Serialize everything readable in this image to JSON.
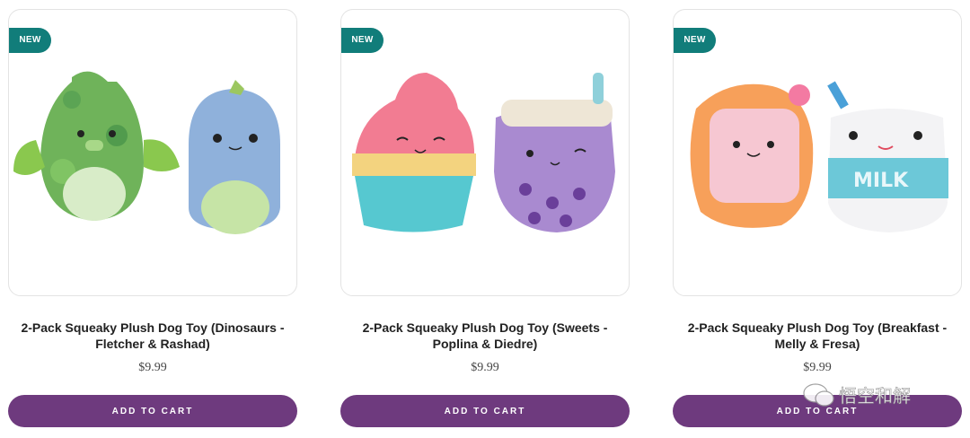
{
  "products": [
    {
      "badge": "NEW",
      "title": "2-Pack Squeaky Plush Dog Toy (Dinosaurs - Fletcher & Rashad)",
      "price": "$9.99",
      "cta": "ADD TO CART"
    },
    {
      "badge": "NEW",
      "title": "2-Pack Squeaky Plush Dog Toy (Sweets - Poplina & Diedre)",
      "price": "$9.99",
      "cta": "ADD TO CART"
    },
    {
      "badge": "NEW",
      "title": "2-Pack Squeaky Plush Dog Toy (Breakfast - Melly & Fresa)",
      "price": "$9.99",
      "cta": "ADD TO CART"
    }
  ],
  "milk_text": "MILK",
  "watermark": "悟空和解",
  "colors": {
    "badge": "#117d7a",
    "button": "#6e3a7e"
  }
}
